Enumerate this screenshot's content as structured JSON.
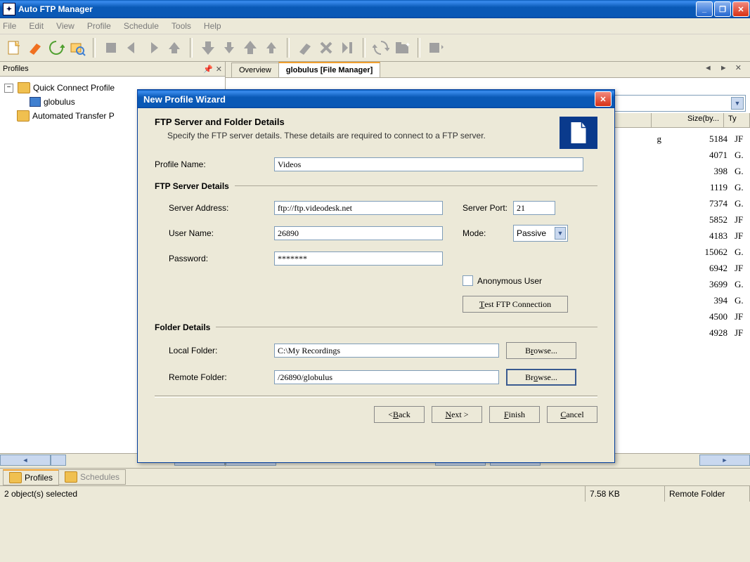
{
  "app": {
    "title": "Auto FTP Manager"
  },
  "menu": [
    "File",
    "Edit",
    "View",
    "Profile",
    "Schedule",
    "Tools",
    "Help"
  ],
  "profiles_panel": {
    "title": "Profiles",
    "tree": {
      "quick": "Quick Connect Profile",
      "globulus": "globulus",
      "automated": "Automated Transfer P"
    }
  },
  "tabs": {
    "overview": "Overview",
    "active": "globulus [File Manager]"
  },
  "columns": {
    "size": "Size(by...",
    "type": "Ty"
  },
  "file_rows": [
    {
      "size": "5184",
      "type": "JF"
    },
    {
      "size": "4071",
      "type": "G."
    },
    {
      "size": "398",
      "type": "G."
    },
    {
      "size": "1119",
      "type": "G."
    },
    {
      "size": "7374",
      "type": "G."
    },
    {
      "size": "5852",
      "type": "JF"
    },
    {
      "size": "4183",
      "type": "JF"
    },
    {
      "size": "15062",
      "type": "G."
    },
    {
      "size": "6942",
      "type": "JF"
    },
    {
      "size": "3699",
      "type": "G."
    },
    {
      "size": "394",
      "type": "G."
    },
    {
      "size": "4500",
      "type": "JF"
    },
    {
      "size": "4928",
      "type": "JF"
    }
  ],
  "partial_filename": "g",
  "bottom_tabs": {
    "profiles": "Profiles",
    "schedules": "Schedules"
  },
  "status": {
    "left": "2 object(s) selected",
    "size": "7.58 KB",
    "right": "Remote Folder"
  },
  "dialog": {
    "title": "New Profile Wizard",
    "heading": "FTP Server and Folder Details",
    "subheading": "Specify the FTP server details. These details are required to connect to a FTP server.",
    "profile_name_label": "Profile Name:",
    "profile_name": "Videos",
    "group_server": "FTP Server Details",
    "server_address_label": "Server Address:",
    "server_address": "ftp://ftp.videodesk.net",
    "server_port_label": "Server Port:",
    "server_port": "21",
    "user_name_label": "User Name:",
    "user_name": "26890",
    "mode_label": "Mode:",
    "mode": "Passive",
    "password_label": "Password:",
    "password": "*******",
    "anonymous_label": "Anonymous User",
    "test_button": "Test FTP Connection",
    "group_folder": "Folder Details",
    "local_folder_label": "Local Folder:",
    "local_folder": "C:\\My Recordings",
    "remote_folder_label": "Remote Folder:",
    "remote_folder": "/26890/globulus",
    "browse": "Browse...",
    "back": "Back",
    "next": "Next >",
    "finish": "Finish",
    "cancel": "Cancel"
  }
}
